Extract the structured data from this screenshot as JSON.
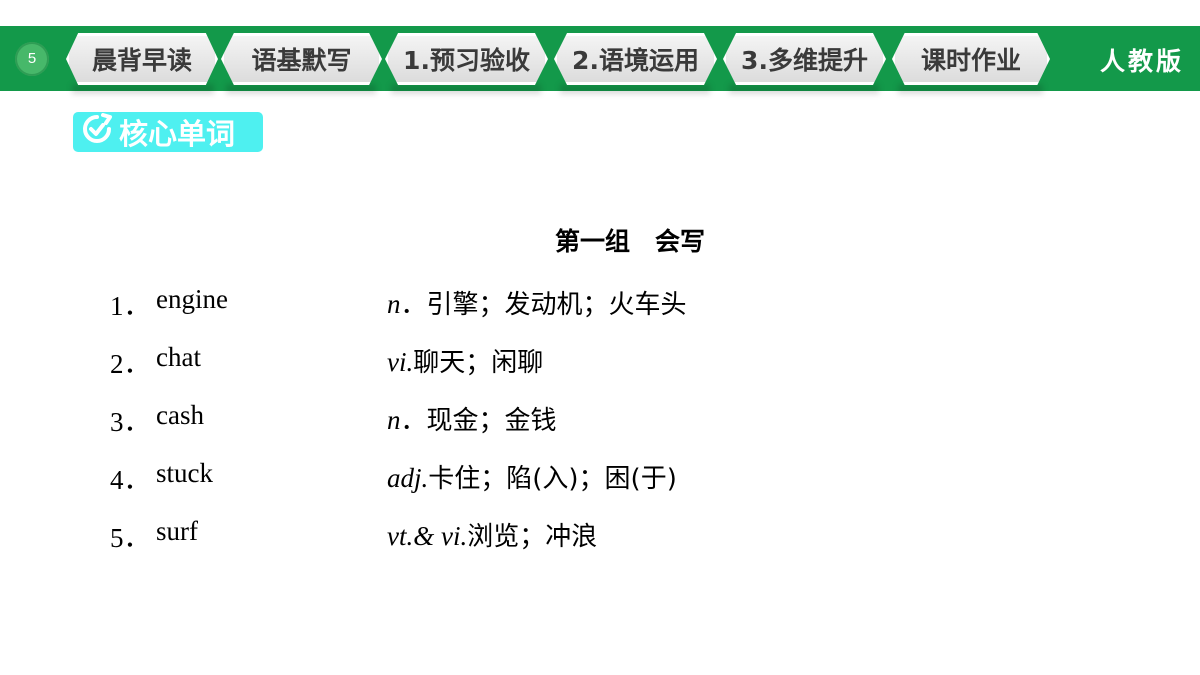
{
  "header": {
    "page_number": "5",
    "tabs": [
      {
        "label": "晨背早读"
      },
      {
        "label": "语基默写"
      },
      {
        "label": "1.预习验收"
      },
      {
        "label": "2.语境运用"
      },
      {
        "label": "3.多维提升"
      },
      {
        "label": "课时作业"
      }
    ],
    "publisher": "人教版"
  },
  "section": {
    "title": "核心单词",
    "icon": "refresh-check-icon",
    "color": "#4ef0f0"
  },
  "group": {
    "title": "第一组　会写"
  },
  "vocab": [
    {
      "num": "1．",
      "word": "engine",
      "pos": "n",
      "sep": "．",
      "meaning": "引擎；发动机；火车头"
    },
    {
      "num": "2．",
      "word": "chat",
      "pos": "vi",
      "sep": ".",
      "meaning": "聊天；闲聊"
    },
    {
      "num": "3．",
      "word": "cash",
      "pos": "n",
      "sep": "．",
      "meaning": "现金；金钱"
    },
    {
      "num": "4．",
      "word": "stuck",
      "pos": "adj",
      "sep": ".",
      "meaning": "卡住；陷(入)；困(于)"
    },
    {
      "num": "5．",
      "word": "surf",
      "pos": "vt.& vi",
      "sep": ".",
      "meaning": "浏览；冲浪"
    }
  ],
  "colors": {
    "topbar": "#13994a",
    "tab": "#e8e8e8"
  }
}
